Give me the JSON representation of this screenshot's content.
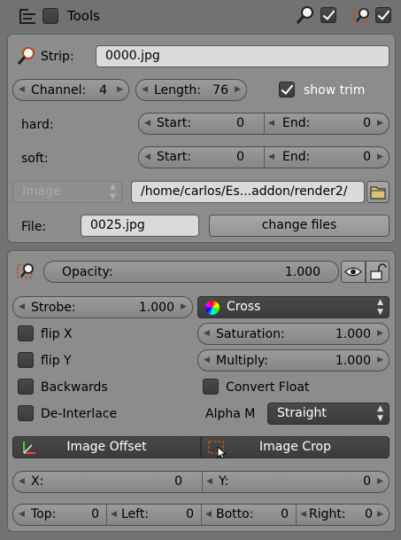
{
  "header": {
    "title": "Tools"
  },
  "strip": {
    "label": "Strip:",
    "value": "0000.jpg"
  },
  "channel": {
    "label": "Channel:",
    "value": "4"
  },
  "length": {
    "label": "Length:",
    "value": "76"
  },
  "show_trim": {
    "label": "show trim",
    "checked": true
  },
  "hard": {
    "label": "hard:",
    "start_label": "Start:",
    "start_value": "0",
    "end_label": "End:",
    "end_value": "0"
  },
  "soft": {
    "label": "soft:",
    "start_label": "Start:",
    "start_value": "0",
    "end_label": "End:",
    "end_value": "0"
  },
  "source_type": {
    "value": "Image"
  },
  "directory": {
    "value": "/home/carlos/Es...addon/render2/"
  },
  "file": {
    "label": "File:",
    "value": "0025.jpg",
    "change_label": "change files"
  },
  "opacity": {
    "label": "Opacity:",
    "value": "1.000"
  },
  "strobe": {
    "label": "Strobe:",
    "value": "1.000"
  },
  "blend": {
    "value": "Cross"
  },
  "flip_x": {
    "label": "flip X"
  },
  "flip_y": {
    "label": "flip Y"
  },
  "saturation": {
    "label": "Saturation:",
    "value": "1.000"
  },
  "multiply": {
    "label": "Multiply:",
    "value": "1.000"
  },
  "backwards": {
    "label": "Backwards"
  },
  "convert_float": {
    "label": "Convert Float"
  },
  "deinterlace": {
    "label": "De-Interlace"
  },
  "alpha_mode": {
    "label": "Alpha M",
    "value": "Straight"
  },
  "image_offset": {
    "label": "Image Offset"
  },
  "image_crop": {
    "label": "Image Crop"
  },
  "offset": {
    "x_label": "X:",
    "x_value": "0",
    "y_label": "Y:",
    "y_value": "0"
  },
  "crop": {
    "top_label": "Top:",
    "top_value": "0",
    "left_label": "Left:",
    "left_value": "0",
    "bottom_label": "Botto:",
    "bottom_value": "0",
    "right_label": "Right:",
    "right_value": "0"
  }
}
